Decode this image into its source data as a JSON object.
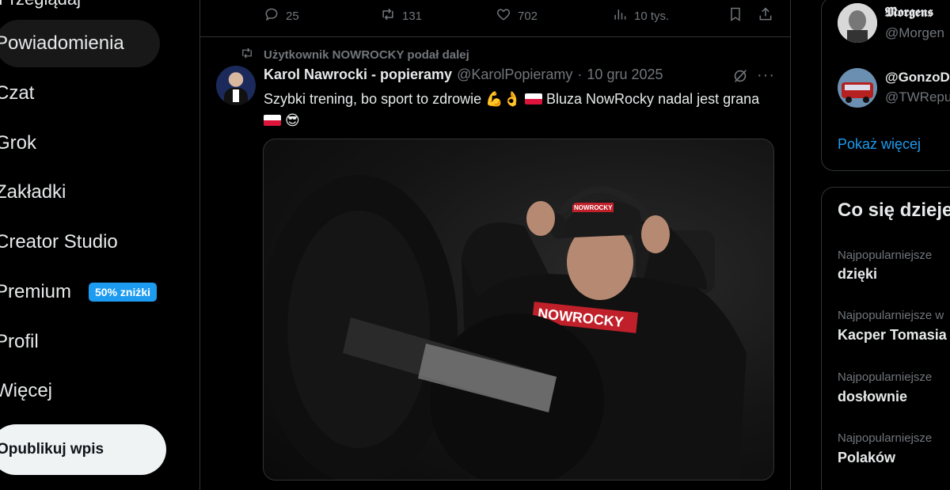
{
  "sidebar": {
    "top_cut_label": "Przeglądaj",
    "items": [
      {
        "label": "Powiadomienia"
      },
      {
        "label": "Czat"
      },
      {
        "label": "Grok"
      },
      {
        "label": "Zakładki"
      },
      {
        "label": "Creator Studio"
      },
      {
        "label": "Premium",
        "badge": "50% zniżki"
      },
      {
        "label": "Profil"
      },
      {
        "label": "Więcej"
      }
    ],
    "post_button": "Opublikuj wpis"
  },
  "prev_tweet_actions": {
    "replies": "25",
    "reposts": "131",
    "likes": "702",
    "views": "10 tys."
  },
  "tweet": {
    "repost_label": "Użytkownik NOWROCKY podał dalej",
    "author_name": "Karol Nawrocki - popieramy",
    "author_handle": "@KarolPopieramy",
    "separator": "·",
    "date": "10 gru 2025",
    "text_part1": "Szybki trening, bo sport to zdrowie",
    "emoji1": "💪👌",
    "text_part2": "Bluza NowRocky nadal jest grana",
    "emoji2": "😎",
    "more": "···",
    "media_cap_text": "NOWROCKY",
    "media_hoodie_text": "NOWROCKY"
  },
  "right": {
    "who_to_follow": [
      {
        "name": "𝕸𝖔𝖗𝖌𝖊𝖓𝖘",
        "handle": "@Morgen"
      },
      {
        "name": "@GonzoD",
        "handle": "@TWRepu"
      }
    ],
    "show_more": "Pokaż więcej",
    "trends_title": "Co się dzieje",
    "trends": [
      {
        "label": "Najpopularniejsze",
        "name": "dzięki"
      },
      {
        "label": "Najpopularniejsze w",
        "name": "Kacper Tomasia"
      },
      {
        "label": "Najpopularniejsze",
        "name": "dosłownie"
      },
      {
        "label": "Najpopularniejsze",
        "name": "Polaków"
      }
    ]
  },
  "colors": {
    "accent": "#1d9bf0",
    "background": "#000000",
    "muted": "#71767b",
    "border": "#2f3336"
  }
}
